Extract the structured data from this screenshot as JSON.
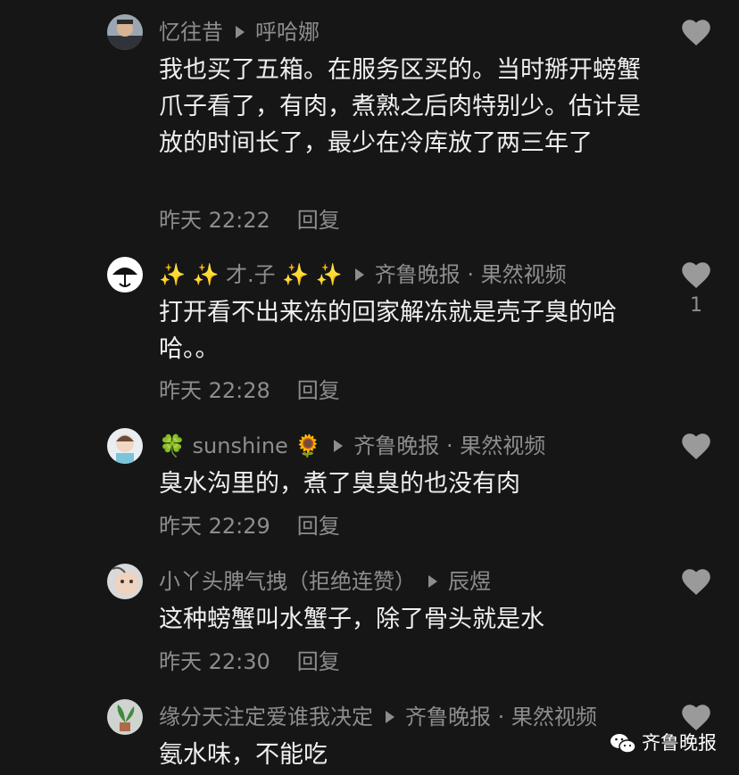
{
  "comments": [
    {
      "username": "忆往昔",
      "reply_to": "呼哈娜",
      "text": "我也买了五箱。在服务区买的。当时掰开螃蟹爪子看了，有肉，煮熟之后肉特别少。估计是放的时间长了，最少在冷库放了两三年了",
      "time": "昨天 22:22",
      "reply_label": "回复",
      "likes": "",
      "avatar_icon": "person-photo-avatar"
    },
    {
      "username": "✨ ✨ 才.子 ✨ ✨",
      "reply_to": "齐鲁晚报 · 果然视频",
      "text": "打开看不出来冻的回家解冻就是壳子臭的哈哈。。",
      "time": "昨天 22:28",
      "reply_label": "回复",
      "likes": "1",
      "avatar_icon": "umbrella-avatar"
    },
    {
      "username": "🍀 sunshine 🌻",
      "reply_to": "齐鲁晚报 · 果然视频",
      "text": "臭水沟里的，煮了臭臭的也没有肉",
      "time": "昨天 22:29",
      "reply_label": "回复",
      "likes": "",
      "avatar_icon": "cartoon-avatar"
    },
    {
      "username": "小丫头脾气拽（拒绝连赞）",
      "reply_to": "辰煜",
      "text": "这种螃蟹叫水蟹子，除了骨头就是水",
      "time": "昨天 22:30",
      "reply_label": "回复",
      "likes": "",
      "avatar_icon": "face-avatar"
    },
    {
      "username": "缘分天注定爱谁我决定",
      "reply_to": "齐鲁晚报 · 果然视频",
      "text": "氨水味，不能吃",
      "time": "",
      "reply_label": "",
      "likes": "",
      "avatar_icon": "plant-avatar"
    }
  ],
  "watermark": {
    "text": "齐鲁晚报",
    "icon": "wechat-icon"
  },
  "colors": {
    "background": "#161616",
    "muted": "#8d8d8d",
    "text": "#efefef",
    "heart": "#9a9a9a"
  }
}
